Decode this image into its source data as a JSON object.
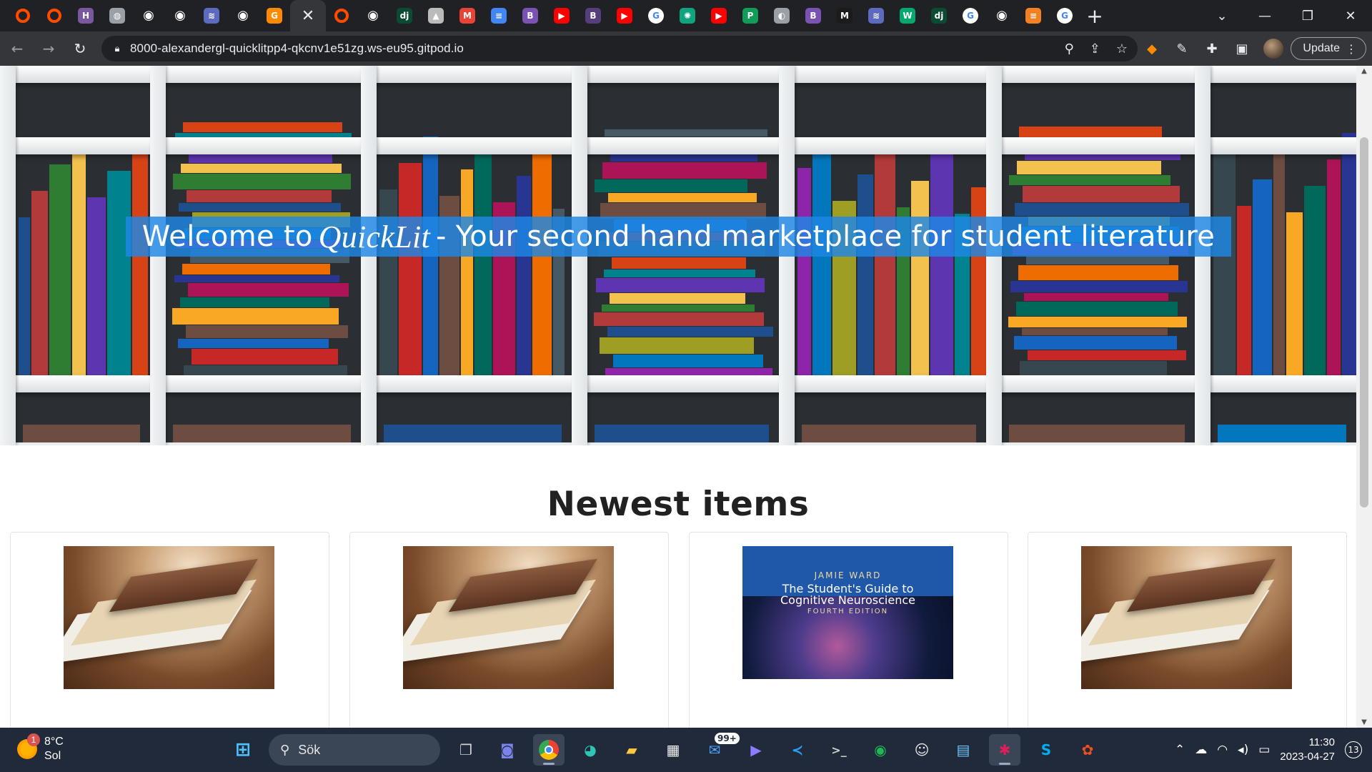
{
  "browser": {
    "tabs": [
      {
        "icon": "opera-icon",
        "color": "#ff4a00"
      },
      {
        "icon": "opera-icon",
        "color": "#ff4a00"
      },
      {
        "icon": "heroku-icon",
        "color": "#79589f",
        "glyph": "H"
      },
      {
        "icon": "globe-icon",
        "color": "#9aa0a6",
        "glyph": "◍"
      },
      {
        "icon": "github-icon",
        "color": "#ffffff",
        "glyph": "◉"
      },
      {
        "icon": "github-icon",
        "color": "#ffffff",
        "glyph": "◉"
      },
      {
        "icon": "app-icon",
        "color": "#5c6bc0",
        "glyph": "≋"
      },
      {
        "icon": "github-icon",
        "color": "#ffffff",
        "glyph": "◉"
      },
      {
        "icon": "gitpod-icon",
        "color": "#ff8a00",
        "glyph": "G"
      },
      {
        "icon": "close-icon",
        "active": true
      },
      {
        "icon": "opera-icon",
        "color": "#ff4a00"
      },
      {
        "icon": "github-icon",
        "color": "#ffffff",
        "glyph": "◉"
      },
      {
        "icon": "django-icon",
        "color": "#0c4b33",
        "glyph": "dj"
      },
      {
        "icon": "heroku-cat-icon",
        "color": "#bbbbbb",
        "glyph": "▲"
      },
      {
        "icon": "gmail-icon",
        "color": "#ea4335",
        "glyph": "M"
      },
      {
        "icon": "docs-icon",
        "color": "#4285f4",
        "glyph": "≡"
      },
      {
        "icon": "bootstrap-icon",
        "color": "#7952b3",
        "glyph": "B"
      },
      {
        "icon": "youtube-icon",
        "color": "#ff0000",
        "glyph": "▶"
      },
      {
        "icon": "bootstrap-icon",
        "color": "#563d7c",
        "glyph": "B"
      },
      {
        "icon": "youtube-icon",
        "color": "#ff0000",
        "glyph": "▶"
      },
      {
        "icon": "google-icon",
        "color": "#ffffff",
        "glyph": "G"
      },
      {
        "icon": "chatgpt-icon",
        "color": "#10a37f",
        "glyph": "✺"
      },
      {
        "icon": "youtube-icon",
        "color": "#ff0000",
        "glyph": "▶"
      },
      {
        "icon": "pdf-icon",
        "color": "#0f9d58",
        "glyph": "P"
      },
      {
        "icon": "globe-icon",
        "color": "#9aa0a6",
        "glyph": "◐"
      },
      {
        "icon": "bootstrap-icon",
        "color": "#7952b3",
        "glyph": "B"
      },
      {
        "icon": "mdn-icon",
        "color": "#1b1b1b",
        "glyph": "M"
      },
      {
        "icon": "app-icon",
        "color": "#5c6bc0",
        "glyph": "≋"
      },
      {
        "icon": "w3schools-icon",
        "color": "#04aa6d",
        "glyph": "W"
      },
      {
        "icon": "django-icon",
        "color": "#0c4b33",
        "glyph": "dj"
      },
      {
        "icon": "google-icon",
        "color": "#ffffff",
        "glyph": "G"
      },
      {
        "icon": "github-icon",
        "color": "#ffffff",
        "glyph": "◉"
      },
      {
        "icon": "stackoverflow-icon",
        "color": "#f48024",
        "glyph": "≡"
      },
      {
        "icon": "google-icon",
        "color": "#ffffff",
        "glyph": "G"
      }
    ],
    "url": "8000-alexandergl-quicklitpp4-qkcnv1e51zg.ws-eu95.gitpod.io",
    "update_label": "Update"
  },
  "page": {
    "welcome_prefix": "Welcome to",
    "brand": "QuickLit",
    "welcome_suffix": "- Your second hand marketplace for student literature",
    "section_title": "Newest items",
    "items": [
      {
        "type": "generic-book"
      },
      {
        "type": "generic-book"
      },
      {
        "type": "cover",
        "author": "JAMIE WARD",
        "title_line1": "The Student's Guide to",
        "title_line2": "Cognitive Neuroscience",
        "edition": "FOURTH EDITION"
      },
      {
        "type": "generic-book"
      }
    ]
  },
  "taskbar": {
    "weather_temp": "8°C",
    "weather_desc": "Sol",
    "weather_badge": "1",
    "search_label": "Sök",
    "mail_badge": "99+",
    "time": "11:30",
    "date": "2023-04-27",
    "notification_count": "13"
  }
}
